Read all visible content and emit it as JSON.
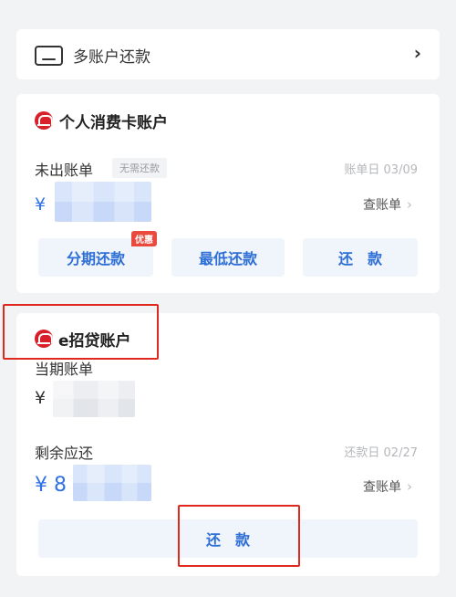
{
  "multi_account": {
    "label": "多账户还款",
    "chevron": "›",
    "icon": "wallet-icon"
  },
  "credit_card": {
    "title": "个人消费卡账户",
    "bill_status": "未出账单",
    "no_pay_tag": "无需还款",
    "bill_date": "账单日 03/09",
    "currency": "¥",
    "view_bill": "查账单",
    "view_bill_arrow": "›",
    "buttons": [
      {
        "label": "分期还款",
        "badge": "优惠"
      },
      {
        "label": "最低还款"
      },
      {
        "label": "还　款"
      }
    ]
  },
  "eloan": {
    "title": "e招贷账户",
    "current_bill": "当期账单",
    "currency": "¥",
    "remaining": "剩余应还",
    "repay_date": "还款日 02/27",
    "remaining_prefix": "¥ 8",
    "view_bill": "查账单",
    "view_bill_arrow": "›",
    "repay_button": "还　款"
  },
  "colors": {
    "accent_blue": "#2e6fd6",
    "brand_red": "#d8202a",
    "highlight_frame": "#e0281e"
  }
}
